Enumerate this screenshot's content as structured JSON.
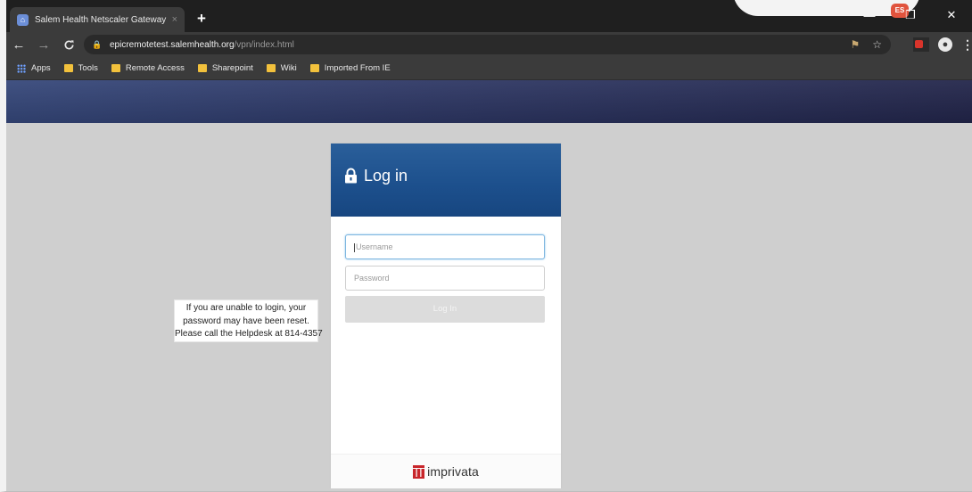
{
  "browser": {
    "tab_title": "Salem Health Netscaler Gateway",
    "tab_close": "×",
    "new_tab": "+",
    "window_controls": {
      "minimize": "—",
      "restore": "❐",
      "close": "✕"
    },
    "extension_badge": "ES",
    "url_host": "epicremotetest.salemhealth.org",
    "url_path": "/vpn/index.html",
    "bookmarks": [
      {
        "label": "Apps",
        "icon": "apps-grid-icon"
      },
      {
        "label": "Tools",
        "icon": "folder-icon"
      },
      {
        "label": "Remote Access",
        "icon": "folder-icon"
      },
      {
        "label": "Sharepoint",
        "icon": "folder-icon"
      },
      {
        "label": "Wiki",
        "icon": "folder-icon"
      },
      {
        "label": "Imported From IE",
        "icon": "folder-icon"
      }
    ]
  },
  "help_notice": {
    "line1": "If you are unable to login, your",
    "line2": "password may have been reset.",
    "line3": "Please call the Helpdesk at 814-4357"
  },
  "login": {
    "title": "Log in",
    "username_placeholder": "Username",
    "password_placeholder": "Password",
    "button_label": "Log In"
  },
  "footer": {
    "brand": "imprivata"
  },
  "colors": {
    "header_blue": "#1c4f8c",
    "banner": "#2e3866",
    "page_bg": "#cfcfcf",
    "brand_red": "#c8262b"
  }
}
